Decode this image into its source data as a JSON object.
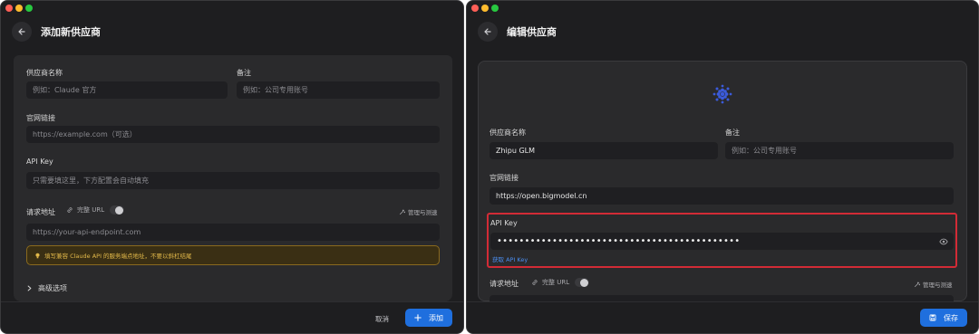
{
  "left": {
    "title": "添加新供应商",
    "fields": {
      "name_label": "供应商名称",
      "name_placeholder": "例如：Claude 官方",
      "note_label": "备注",
      "note_placeholder": "例如：公司专用账号",
      "website_label": "官网链接",
      "website_placeholder": "https://example.com（可选）",
      "apikey_label": "API Key",
      "apikey_placeholder": "只需要填这里，下方配置会自动填充",
      "endpoint_label": "请求地址",
      "full_url_label": "完整 URL",
      "manage_label": "管理与测速",
      "endpoint_placeholder": "https://your-api-endpoint.com",
      "hint": "填写兼容 Claude API 的服务端点地址，不要以斜杠结尾",
      "advanced_label": "高级选项"
    },
    "footer": {
      "cancel": "取消",
      "submit": "添加"
    }
  },
  "right": {
    "title": "编辑供应商",
    "fields": {
      "name_label": "供应商名称",
      "name_value": "Zhipu GLM",
      "note_label": "备注",
      "note_placeholder": "例如：公司专用账号",
      "website_label": "官网链接",
      "website_value": "https://open.bigmodel.cn",
      "apikey_label": "API Key",
      "apikey_value": "••••••••••••••••••••••••••••••••••••••••••••",
      "get_apikey_link": "获取 API Key",
      "endpoint_label": "请求地址",
      "full_url_label": "完整 URL",
      "manage_label": "管理与测速"
    },
    "footer": {
      "submit": "保存"
    }
  },
  "colors": {
    "background": "#1e1e20",
    "panel": "#2a2a2c",
    "input": "#1f1f22",
    "accent": "#1f6fde",
    "highlight": "#d22b36",
    "hint_text": "#e3b94a"
  },
  "icons": [
    "back-arrow-icon",
    "link-icon",
    "wand-icon",
    "lightbulb-icon",
    "chevron-right-icon",
    "plus-icon",
    "save-icon",
    "eye-icon",
    "provider-logo-icon"
  ]
}
